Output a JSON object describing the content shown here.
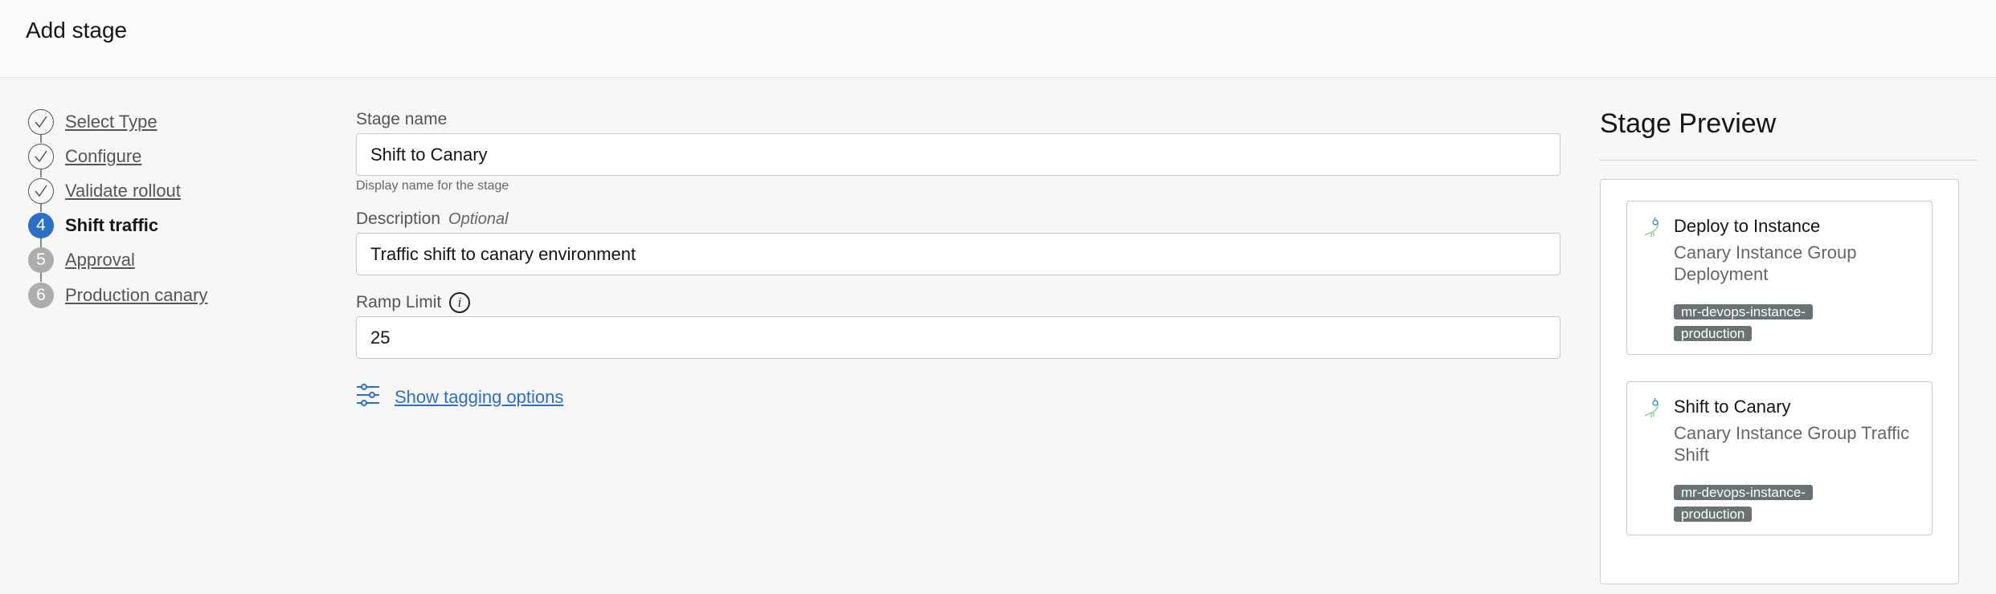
{
  "header": {
    "title": "Add stage"
  },
  "steps": [
    {
      "number": "1",
      "label": "Select Type",
      "state": "done"
    },
    {
      "number": "2",
      "label": "Configure",
      "state": "done"
    },
    {
      "number": "3",
      "label": "Validate rollout",
      "state": "done"
    },
    {
      "number": "4",
      "label": "Shift traffic",
      "state": "current"
    },
    {
      "number": "5",
      "label": "Approval",
      "state": "todo"
    },
    {
      "number": "6",
      "label": "Production canary",
      "state": "todo"
    }
  ],
  "form": {
    "stage_name": {
      "label": "Stage name",
      "value": "Shift to Canary",
      "help": "Display name for the stage"
    },
    "description": {
      "label": "Description",
      "optional": "Optional",
      "value": "Traffic shift to canary environment"
    },
    "ramp_limit": {
      "label": "Ramp Limit",
      "value": "25"
    },
    "tagging_link": "Show tagging options"
  },
  "preview": {
    "title": "Stage Preview",
    "cards": [
      {
        "title": "Deploy to Instance",
        "subtitle": "Canary Instance Group Deployment",
        "tag": "mr-devops-instance-production"
      },
      {
        "title": "Shift to Canary",
        "subtitle": "Canary Instance Group Traffic Shift",
        "tag": "mr-devops-instance-production"
      }
    ]
  },
  "colors": {
    "accent": "#2c6fc7",
    "tag_bg": "#697373"
  }
}
